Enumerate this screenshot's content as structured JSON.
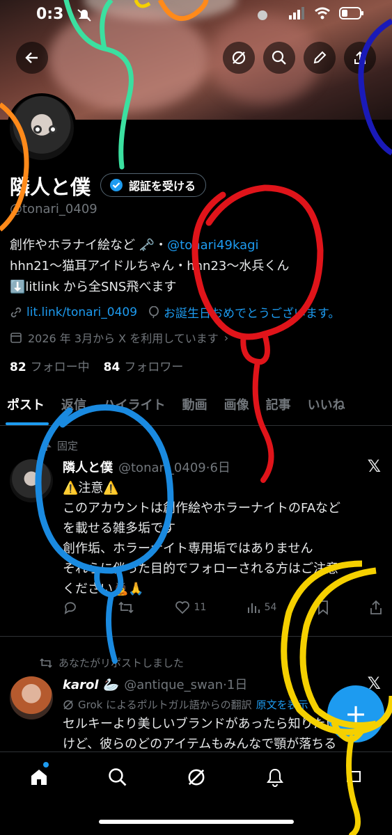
{
  "status_bar": {
    "time": "0:3"
  },
  "header": {
    "back_icon": "arrow-left-icon",
    "top_actions": [
      "grok-icon",
      "search-icon",
      "edit-icon",
      "share-icon"
    ]
  },
  "profile": {
    "name": "隣人と僕",
    "verify_label": "認証を受ける",
    "handle": "@tonari_0409",
    "bio_line1_prefix": "創作やホラナイ絵など 🗝️・",
    "bio_line1_link": "@tonari49kagi",
    "bio_line2": "hhn21～猫耳アイドルちゃん・hhn23～水兵くん",
    "bio_line3": "⬇️litlink から全SNS飛べます",
    "website": "lit.link/tonari_0409",
    "birthday": "お誕生日おめでとうございます。",
    "joined": "2026 年 3月から X を利用しています",
    "following_count": "82",
    "following_label": "フォロー中",
    "followers_count": "84",
    "followers_label": "フォロワー"
  },
  "tabs": [
    "ポスト",
    "返信",
    "ハイライト",
    "動画",
    "画像",
    "記事",
    "いいね"
  ],
  "pinned_post": {
    "pinned_label": "固定",
    "author": "隣人と僕",
    "meta": "@tonari_0409·6日",
    "line1": "⚠️注意⚠️",
    "line2": "このアカウントは創作絵やホラーナイトのFAなど",
    "line3": "を載せる雑多垢です",
    "line4": "創作垢、ホラーナイト専用垢ではありません",
    "line5": "それらに伴った目的でフォローされる方はご注意",
    "line6": "ください🙇🙏",
    "likes": "11",
    "views": "54"
  },
  "repost": {
    "repost_label": "あなたがリポストしました",
    "author": "karol 🦢",
    "meta": "@antique_swan·1日",
    "translate_text": "Grok によるポルトガル語からの翻訳",
    "translate_link": "原文を表示",
    "line1": "セルキーより美しいブランドがあったら知りたい",
    "line2": "けど、彼らのどのアイテムもみんなで顎が落ちる"
  },
  "fab_label": "+",
  "bottom_nav": [
    "home-icon",
    "search-icon",
    "grok-icon",
    "notifications-icon",
    "messages-icon"
  ]
}
